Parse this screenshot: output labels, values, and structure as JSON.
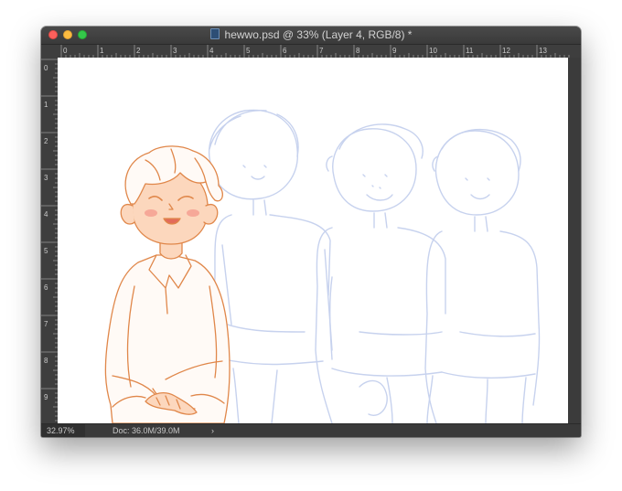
{
  "window": {
    "title": "hewwo.psd @ 33% (Layer 4, RGB/8) *",
    "buttons": {
      "close": "close",
      "minimize": "minimize",
      "maximize": "zoom"
    }
  },
  "ruler": {
    "top_labels": [
      "0",
      "1",
      "2",
      "3",
      "4",
      "5",
      "6",
      "7",
      "8",
      "9",
      "10",
      "11",
      "12",
      "13"
    ],
    "left_labels": [
      "0",
      "1",
      "2",
      "3",
      "4",
      "5",
      "6",
      "7",
      "8",
      "9"
    ]
  },
  "status": {
    "zoom": "32.97%",
    "doc": "Doc: 36.0M/39.0M",
    "menu_arrow": "›"
  },
  "colors": {
    "window_bg": "#3b3b3b",
    "sketch_blue": "#c7d2ee",
    "line_orange": "#e0874a",
    "skin": "#fcd7bd",
    "blush": "#f6a898"
  }
}
